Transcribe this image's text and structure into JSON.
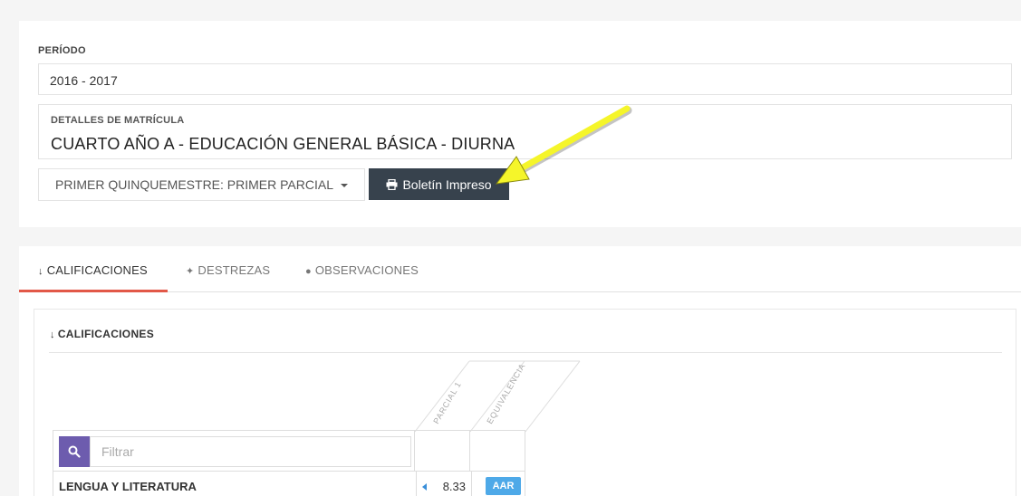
{
  "period": {
    "label": "PERÍODO",
    "value": "2016 - 2017"
  },
  "enrollment": {
    "label": "DETALLES DE MATRÍCULA",
    "value": "CUARTO AÑO A - EDUCACIÓN GENERAL BÁSICA - DIURNA"
  },
  "toolbar": {
    "term_select": "PRIMER QUINQUEMESTRE: PRIMER PARCIAL",
    "print_button": "Boletín Impreso"
  },
  "tabs": [
    {
      "label": "CALIFICACIONES",
      "icon": "sort-numeric-icon",
      "active": true
    },
    {
      "label": "DESTREZAS",
      "icon": "puzzle-icon",
      "active": false
    },
    {
      "label": "OBSERVACIONES",
      "icon": "comments-icon",
      "active": false
    }
  ],
  "grades_card": {
    "title": "CALIFICACIONES",
    "columns": [
      "PARCIAL 1",
      "EQUIVALENCIA"
    ],
    "filter_placeholder": "Filtrar",
    "rows": [
      {
        "subject": "LENGUA Y LITERATURA",
        "grade": "8.33",
        "equivalence": "AAR"
      }
    ]
  },
  "colors": {
    "print_button": "#37424d",
    "active_tab": "#e25848",
    "search_button": "#6d5cae",
    "badge": "#4ea9e8",
    "annotation_arrow": "#f5f52a"
  }
}
